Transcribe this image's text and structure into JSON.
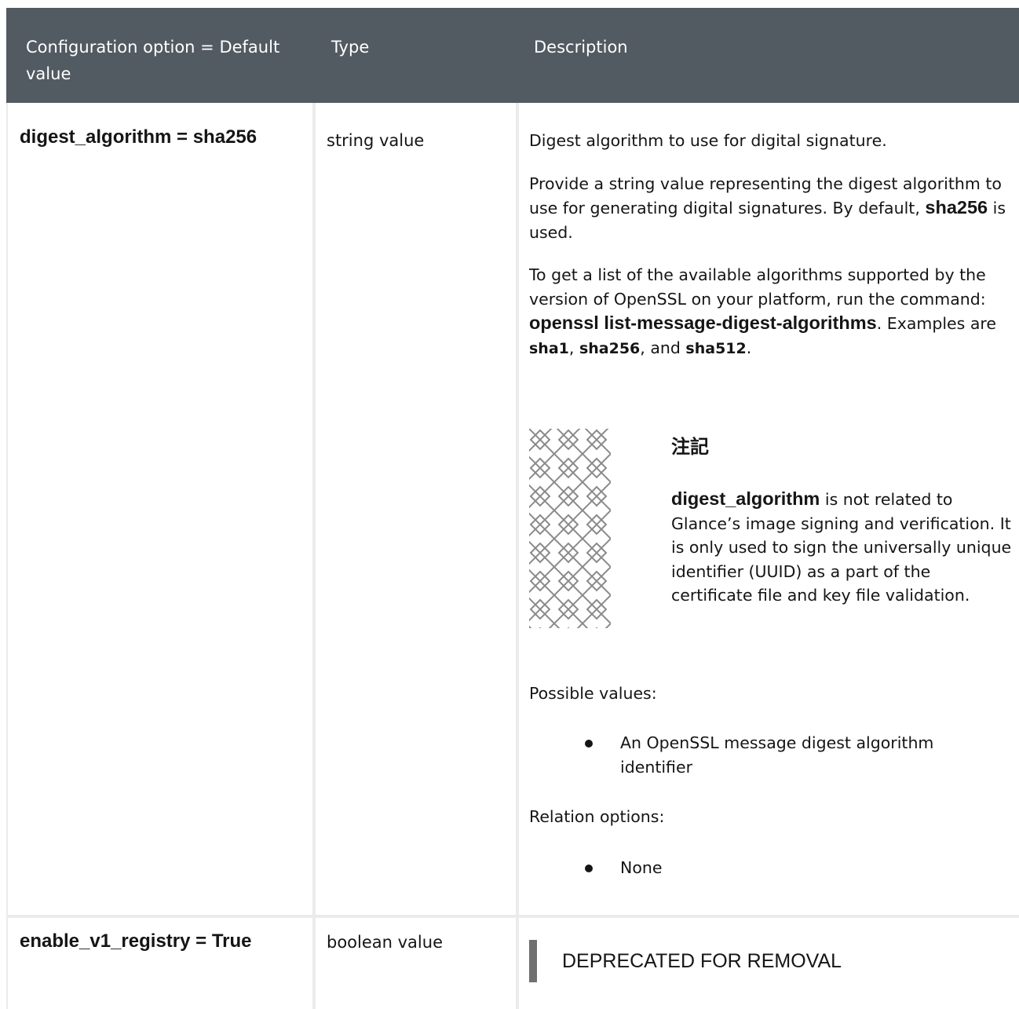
{
  "header": {
    "col1": "Configuration option = Default value",
    "col2": "Type",
    "col3": "Description"
  },
  "rows": [
    {
      "option": "digest_algorithm = sha256",
      "type": "string value",
      "desc": {
        "p1": "Digest algorithm to use for digital signature.",
        "p2_pre": "Provide a string value representing the digest algorithm to use for generating digital signatures. By default,",
        "p2_bold": "sha256",
        "p2_post": "is used.",
        "p3_pre": "To get a list of the available algorithms supported by the version of OpenSSL on your platform, run the command:",
        "p3_bold": "openssl list-message-digest-algorithms",
        "p3_mid": ". Examples are",
        "p3_code1": "sha1",
        "p3_sep1": ",",
        "p3_code2": "sha256",
        "p3_sep2": ", and",
        "p3_code3": "sha512",
        "p3_end": ".",
        "note": {
          "title": "注記",
          "bold": "digest_algorithm",
          "text": "is not related to Glance’s image signing and verification. It is only used to sign the universally unique identifier (UUID) as a part of the certificate file and key file validation.",
          "icon": "note-pattern-icon"
        },
        "possible_label": "Possible values:",
        "possible_items": [
          "An OpenSSL message digest algorithm identifier"
        ],
        "relation_label": "Relation options:",
        "relation_items": [
          "None"
        ]
      }
    },
    {
      "option": "enable_v1_registry = True",
      "type": "boolean value",
      "deprecated": "DEPRECATED FOR REMOVAL"
    }
  ]
}
